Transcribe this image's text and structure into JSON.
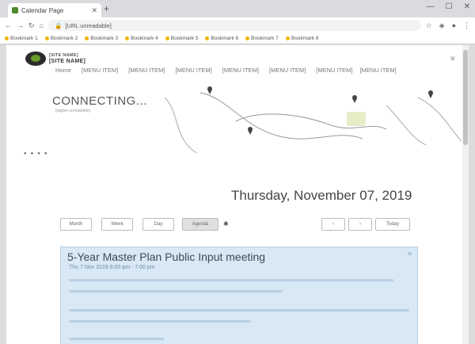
{
  "browser": {
    "tab_title": "Calendar Page",
    "url": "[URL unreadable]",
    "bookmarks": [
      "Bookmark 1",
      "Bookmark 2",
      "Bookmark 3",
      "Bookmark 4",
      "Bookmark 5",
      "Bookmark 6",
      "Bookmark 7",
      "Bookmark 8"
    ]
  },
  "site": {
    "logo_line1": "[SITE NAME]",
    "logo_line2": "[SITE NAME]",
    "nav": [
      "Home",
      "[MENU ITEM]",
      "[MENU ITEM]",
      "[MENU ITEM]",
      "[MENU ITEM]",
      "[MENU ITEM]",
      "[MENU ITEM]",
      "[MENU ITEM]"
    ],
    "hero_title": "CONNECTING...",
    "hero_subtitle": "[tagline unreadable]"
  },
  "calendar": {
    "date_heading": "Thursday, November 07, 2019",
    "view_buttons": [
      "Month",
      "Week",
      "Day",
      "Agenda"
    ],
    "nav_buttons": [
      "‹",
      "›",
      "Today"
    ]
  },
  "event": {
    "title": "5-Year Master Plan Public Input meeting",
    "time": "Thu 7 Nov 2019 6:00 pm - 7:00 pm"
  }
}
